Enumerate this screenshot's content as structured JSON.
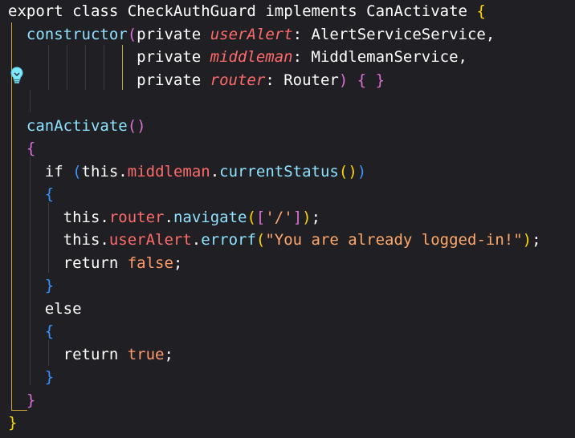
{
  "editor": {
    "lines": [
      {
        "tokens": [
          {
            "t": "export ",
            "c": "kw"
          },
          {
            "t": "class ",
            "c": "kw"
          },
          {
            "t": "CheckAuthGuard ",
            "c": "cls"
          },
          {
            "t": "implements ",
            "c": "kw"
          },
          {
            "t": "CanActivate ",
            "c": "cls"
          },
          {
            "t": "{",
            "c": "b1"
          }
        ]
      },
      {
        "tokens": [
          {
            "t": "  constructor",
            "c": "fn"
          },
          {
            "t": "(",
            "c": "b2"
          },
          {
            "t": "private ",
            "c": "kw"
          },
          {
            "t": "userAlert",
            "c": "param"
          },
          {
            "t": ": AlertServiceService,",
            "c": "punct"
          }
        ]
      },
      {
        "tokens": [
          {
            "t": "              private ",
            "c": "kw"
          },
          {
            "t": "middleman",
            "c": "param"
          },
          {
            "t": ": MiddlemanService,",
            "c": "punct"
          }
        ]
      },
      {
        "tokens": [
          {
            "t": "              private ",
            "c": "kw"
          },
          {
            "t": "router",
            "c": "param"
          },
          {
            "t": ": Router",
            "c": "punct"
          },
          {
            "t": ") ",
            "c": "b2"
          },
          {
            "t": "{ }",
            "c": "b2"
          }
        ]
      },
      {
        "tokens": [
          {
            "t": "",
            "c": "punct"
          }
        ]
      },
      {
        "tokens": [
          {
            "t": "  canActivate",
            "c": "fn"
          },
          {
            "t": "()",
            "c": "b2"
          }
        ]
      },
      {
        "tokens": [
          {
            "t": "  {",
            "c": "b2"
          }
        ]
      },
      {
        "tokens": [
          {
            "t": "    if ",
            "c": "kw"
          },
          {
            "t": "(",
            "c": "b3"
          },
          {
            "t": "this",
            "c": "kw"
          },
          {
            "t": ".",
            "c": "punct"
          },
          {
            "t": "middleman",
            "c": "prop"
          },
          {
            "t": ".",
            "c": "punct"
          },
          {
            "t": "currentStatus",
            "c": "fn"
          },
          {
            "t": "()",
            "c": "b1"
          },
          {
            "t": ")",
            "c": "b3"
          }
        ]
      },
      {
        "tokens": [
          {
            "t": "    {",
            "c": "b3"
          }
        ]
      },
      {
        "tokens": [
          {
            "t": "      this",
            "c": "kw"
          },
          {
            "t": ".",
            "c": "punct"
          },
          {
            "t": "router",
            "c": "prop"
          },
          {
            "t": ".",
            "c": "punct"
          },
          {
            "t": "navigate",
            "c": "fn"
          },
          {
            "t": "(",
            "c": "b1"
          },
          {
            "t": "[",
            "c": "b2"
          },
          {
            "t": "'/'",
            "c": "str"
          },
          {
            "t": "]",
            "c": "b2"
          },
          {
            "t": ")",
            "c": "b1"
          },
          {
            "t": ";",
            "c": "punct"
          }
        ]
      },
      {
        "tokens": [
          {
            "t": "      this",
            "c": "kw"
          },
          {
            "t": ".",
            "c": "punct"
          },
          {
            "t": "userAlert",
            "c": "prop"
          },
          {
            "t": ".",
            "c": "punct"
          },
          {
            "t": "errorf",
            "c": "fn"
          },
          {
            "t": "(",
            "c": "b1"
          },
          {
            "t": "\"You are already logged-in!\"",
            "c": "str"
          },
          {
            "t": ")",
            "c": "b1"
          },
          {
            "t": ";",
            "c": "punct"
          }
        ]
      },
      {
        "tokens": [
          {
            "t": "      return ",
            "c": "kw"
          },
          {
            "t": "false",
            "c": "lit"
          },
          {
            "t": ";",
            "c": "punct"
          }
        ]
      },
      {
        "tokens": [
          {
            "t": "    }",
            "c": "b3"
          }
        ]
      },
      {
        "tokens": [
          {
            "t": "    else",
            "c": "kw"
          }
        ]
      },
      {
        "tokens": [
          {
            "t": "    {",
            "c": "b3"
          }
        ]
      },
      {
        "tokens": [
          {
            "t": "      return ",
            "c": "kw"
          },
          {
            "t": "true",
            "c": "lit"
          },
          {
            "t": ";",
            "c": "punct"
          }
        ]
      },
      {
        "tokens": [
          {
            "t": "    }",
            "c": "b3"
          }
        ]
      },
      {
        "tokens": [
          {
            "t": "  }",
            "c": "b2"
          }
        ]
      },
      {
        "tokens": [
          {
            "t": "}",
            "c": "b1"
          }
        ]
      }
    ]
  },
  "lightbulb_icon": "lightbulb-icon"
}
